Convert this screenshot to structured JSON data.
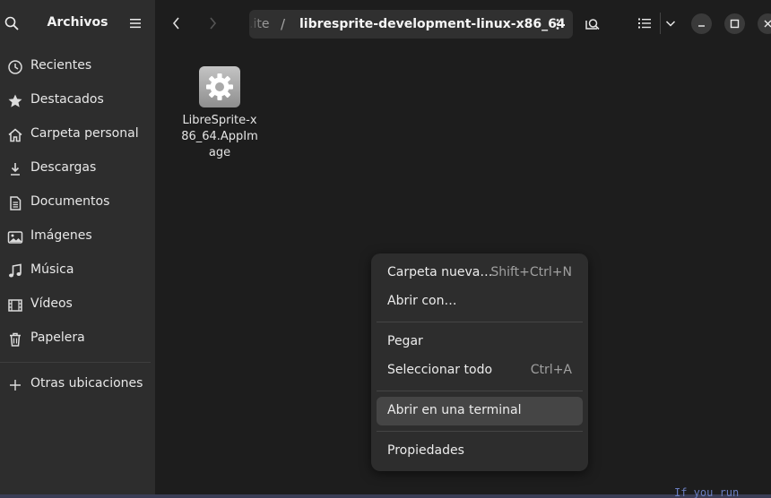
{
  "sidebar": {
    "title": "Archivos",
    "items": [
      {
        "label": "Recientes",
        "icon": "clock-icon"
      },
      {
        "label": "Destacados",
        "icon": "star-icon"
      },
      {
        "label": "Carpeta personal",
        "icon": "home-icon"
      },
      {
        "label": "Descargas",
        "icon": "download-icon"
      },
      {
        "label": "Documentos",
        "icon": "document-icon"
      },
      {
        "label": "Imágenes",
        "icon": "image-icon"
      },
      {
        "label": "Música",
        "icon": "music-icon"
      },
      {
        "label": "Vídeos",
        "icon": "video-icon"
      },
      {
        "label": "Papelera",
        "icon": "trash-icon"
      }
    ],
    "other_locations": "Otras ubicaciones"
  },
  "path": {
    "previous": ".ite",
    "separator": "/",
    "current": "libresprite-development-linux-x86_64"
  },
  "files": [
    {
      "name": "LibreSprite-x86_64.AppImage",
      "icon": "executable-gear-icon"
    }
  ],
  "context_menu": {
    "items": [
      {
        "label": "Carpeta nueva…",
        "shortcut": "Shift+Ctrl+N"
      },
      {
        "label": "Abrir con…",
        "shortcut": ""
      },
      {
        "label": "Pegar",
        "shortcut": ""
      },
      {
        "label": "Seleccionar todo",
        "shortcut": "Ctrl+A"
      },
      {
        "label": "Abrir en una terminal",
        "shortcut": ""
      },
      {
        "label": "Propiedades",
        "shortcut": ""
      }
    ],
    "highlighted": "Abrir en una terminal"
  },
  "background_text": "If you run",
  "colors": {
    "sidebar_bg": "#2d2d2d",
    "content_bg": "#1d1d1d",
    "menu_bg": "#2d2d2d",
    "hover_bg": "#454545"
  }
}
